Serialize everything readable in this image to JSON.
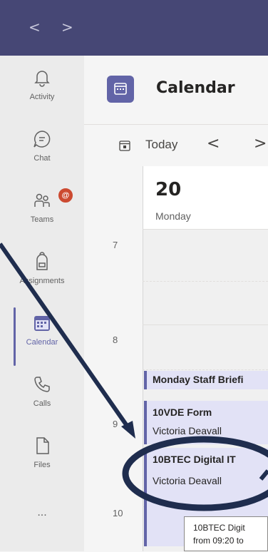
{
  "window": {
    "back": "<",
    "forward": ">"
  },
  "rail": {
    "items": [
      {
        "label": "Activity",
        "icon": "bell-icon"
      },
      {
        "label": "Chat",
        "icon": "chat-icon"
      },
      {
        "label": "Teams",
        "icon": "teams-icon",
        "badge": "@"
      },
      {
        "label": "Assignments",
        "icon": "backpack-icon"
      },
      {
        "label": "Calendar",
        "icon": "calendar-icon",
        "active": true
      },
      {
        "label": "Calls",
        "icon": "phone-icon"
      },
      {
        "label": "Files",
        "icon": "file-icon"
      },
      {
        "label": "...",
        "icon": "more-icon"
      }
    ]
  },
  "header": {
    "title": "Calendar"
  },
  "toolbar": {
    "today_label": "Today",
    "prev": "<",
    "next": ">"
  },
  "day": {
    "number": "20",
    "name": "Monday"
  },
  "hours": [
    "7",
    "8",
    "9",
    "10"
  ],
  "events": [
    {
      "title": "Monday Staff Briefi"
    },
    {
      "title": "10VDE Form",
      "organizer": "Victoria Deavall"
    },
    {
      "title": "10BTEC Digital IT",
      "organizer": "Victoria Deavall"
    }
  ],
  "tooltip": {
    "line1": "10BTEC Digit",
    "line2": "from 09:20 to"
  },
  "colors": {
    "accent": "#6264a7",
    "titlebar": "#464775",
    "annotation": "#1f2d4e",
    "badge": "#cc4a31"
  }
}
